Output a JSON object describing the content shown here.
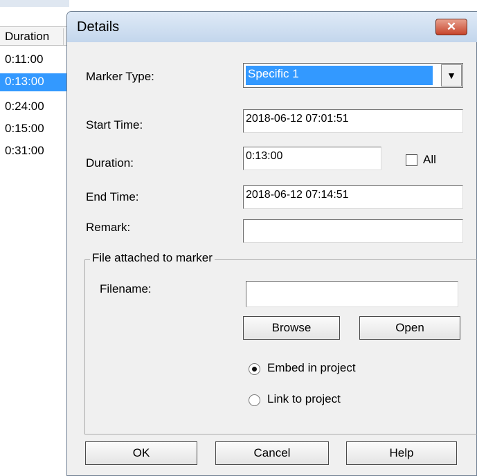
{
  "list": {
    "header": "Duration",
    "rows": [
      "0:11:00",
      "0:13:00",
      "0:24:00",
      "0:15:00",
      "0:31:00"
    ],
    "selected_index": 1
  },
  "dialog": {
    "title": "Details",
    "close_symbol": "✕",
    "marker_type_label": "Marker Type:",
    "marker_type_value": "Specific 1",
    "dropdown_arrow": "▼",
    "start_time_label": "Start Time:",
    "start_time_value": "2018-06-12 07:01:51",
    "duration_label": "Duration:",
    "duration_value": "0:13:00",
    "all_label": "All",
    "end_time_label": "End Time:",
    "end_time_value": "2018-06-12 07:14:51",
    "remark_label": "Remark:",
    "remark_value": "",
    "file_group_label": "File attached to marker",
    "filename_label": "Filename:",
    "filename_value": "",
    "browse_label": "Browse",
    "open_label": "Open",
    "embed_label": "Embed in project",
    "link_label": "Link to project",
    "ok_label": "OK",
    "cancel_label": "Cancel",
    "help_label": "Help"
  }
}
